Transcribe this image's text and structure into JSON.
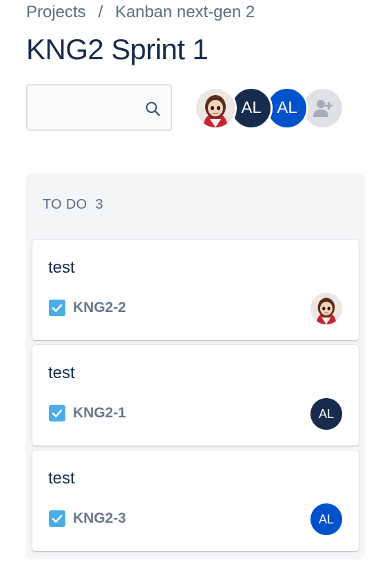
{
  "breadcrumbs": {
    "items": [
      "Projects",
      "Kanban next-gen 2"
    ],
    "separator": "/"
  },
  "page_title": "KNG2 Sprint 1",
  "search": {
    "value": "",
    "placeholder": "",
    "icon": "search-icon"
  },
  "avatars": [
    {
      "type": "photo",
      "initials": "",
      "color": "#f4f5f7"
    },
    {
      "type": "initials",
      "initials": "AL",
      "color": "#172b4d"
    },
    {
      "type": "initials",
      "initials": "AL",
      "color": "#0052cc"
    },
    {
      "type": "add-person",
      "icon": "add-person-icon",
      "color": "#dfe1e6"
    }
  ],
  "column": {
    "name": "TO DO",
    "count": "3",
    "cards": [
      {
        "title": "test",
        "key": "KNG2-2",
        "type_icon": "checkbox-icon",
        "assignee": {
          "type": "photo",
          "initials": ""
        }
      },
      {
        "title": "test",
        "key": "KNG2-1",
        "type_icon": "checkbox-icon",
        "assignee": {
          "type": "initials",
          "initials": "AL",
          "color": "#172b4d"
        }
      },
      {
        "title": "test",
        "key": "KNG2-3",
        "type_icon": "checkbox-icon",
        "assignee": {
          "type": "initials",
          "initials": "AL",
          "color": "#0052cc"
        }
      }
    ]
  },
  "colors": {
    "task_icon": "#4bade8",
    "text": "#172b4d",
    "subtle": "#5e6c84",
    "column_bg": "#f4f5f7"
  }
}
